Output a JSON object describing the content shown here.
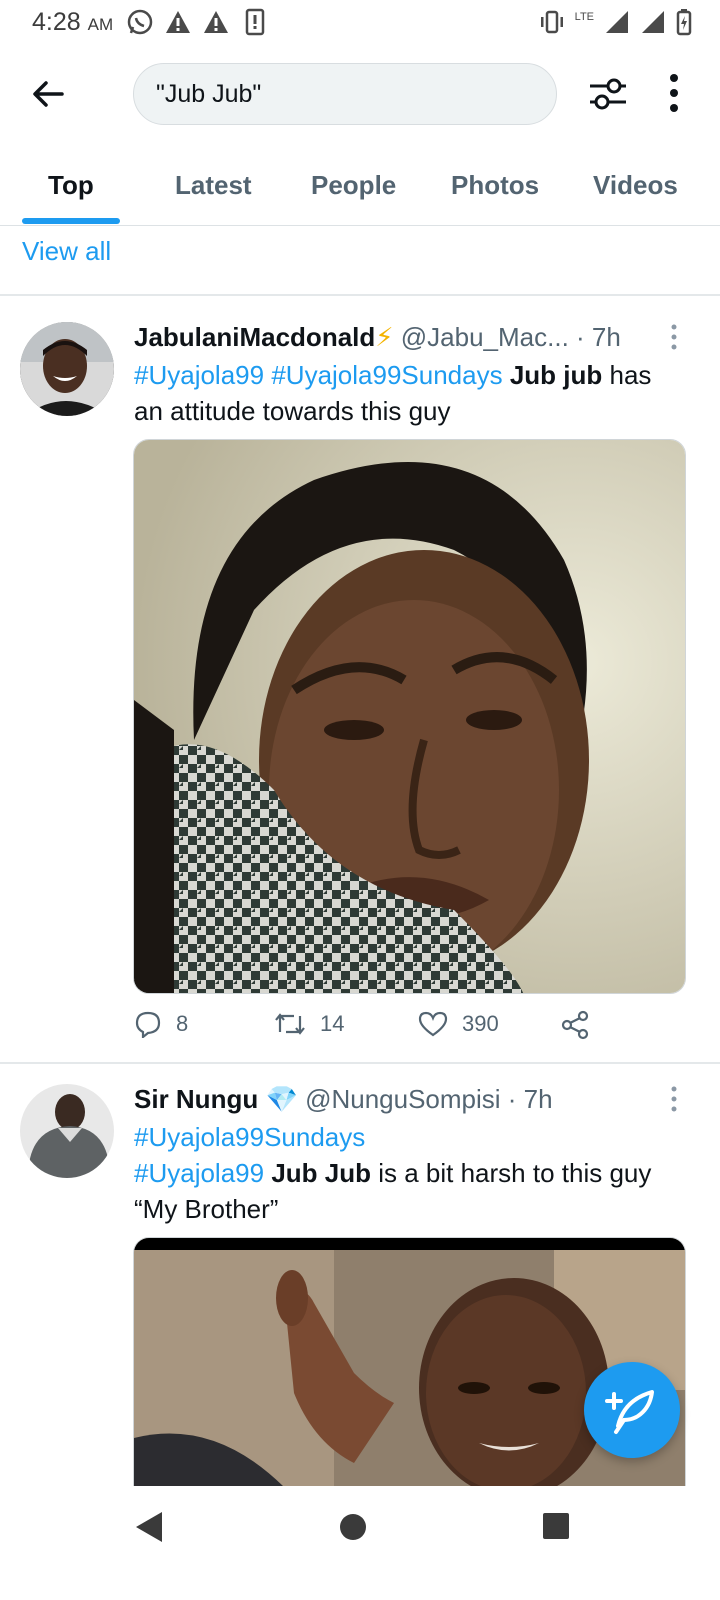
{
  "status_bar": {
    "time": "4:28",
    "ampm": "AM",
    "network": "LTE"
  },
  "search": {
    "query": "\"Jub Jub\""
  },
  "tabs": [
    {
      "label": "Top",
      "active": true
    },
    {
      "label": "Latest",
      "active": false
    },
    {
      "label": "People",
      "active": false
    },
    {
      "label": "Photos",
      "active": false
    },
    {
      "label": "Videos",
      "active": false
    }
  ],
  "view_all_label": "View all",
  "tweets": [
    {
      "name": "JabulaniMacdonald",
      "name_emoji": "⚡",
      "handle": "@Jabu_Mac...",
      "time": "· 7h",
      "text": {
        "tag1": "#Uyajola99",
        "tag2": "#Uyajola99Sundays",
        "bold": "Jub jub",
        "rest": " has an attitude towards this guy"
      },
      "replies": "8",
      "retweets": "14",
      "likes": "390"
    },
    {
      "name": "Sir Nungu",
      "name_emoji": "💎",
      "handle": "@NunguSompisi",
      "time": "· 7h",
      "text": {
        "tag1": "#Uyajola99Sundays",
        "tag2": "#Uyajola99",
        "bold": "Jub Jub",
        "rest": " is a bit harsh to this guy",
        "line3": "“My Brother”"
      }
    }
  ],
  "colors": {
    "accent": "#1d9bf0",
    "text": "#0f1419",
    "muted": "#536471"
  },
  "icons": [
    "back-arrow-icon",
    "filter-icon",
    "more-vertical-icon",
    "reply-icon",
    "retweet-icon",
    "like-icon",
    "share-icon",
    "compose-icon",
    "nav-back-icon",
    "nav-home-icon",
    "nav-recents-icon"
  ]
}
